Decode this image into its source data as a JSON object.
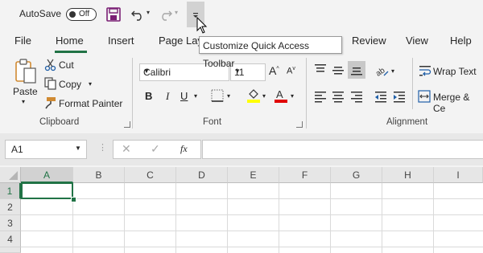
{
  "titlebar": {
    "autosave_label": "AutoSave",
    "autosave_state": "Off",
    "tooltip": "Customize Quick Access Toolbar"
  },
  "tabs": [
    "File",
    "Home",
    "Insert",
    "Page Layout",
    "Review",
    "View",
    "Help"
  ],
  "active_tab": "Home",
  "clipboard": {
    "paste": "Paste",
    "cut": "Cut",
    "copy": "Copy",
    "format_painter": "Format Painter",
    "group": "Clipboard"
  },
  "font": {
    "name": "Calibri",
    "size": "11",
    "group": "Font",
    "bold": "B",
    "italic": "I",
    "underline": "U"
  },
  "alignment": {
    "wrap_text": "Wrap Text",
    "merge_center": "Merge & Ce",
    "group": "Alignment"
  },
  "formula_bar": {
    "name_box": "A1",
    "fx": "fx",
    "value": ""
  },
  "sheet": {
    "columns": [
      "A",
      "B",
      "C",
      "D",
      "E",
      "F",
      "G",
      "H",
      "I"
    ],
    "rows": [
      "1",
      "2",
      "3",
      "4"
    ],
    "active_cell": "A1"
  },
  "colors": {
    "accent": "#217346",
    "font_color_bar": "#e00000",
    "highlight_bar": "#ffff00"
  }
}
